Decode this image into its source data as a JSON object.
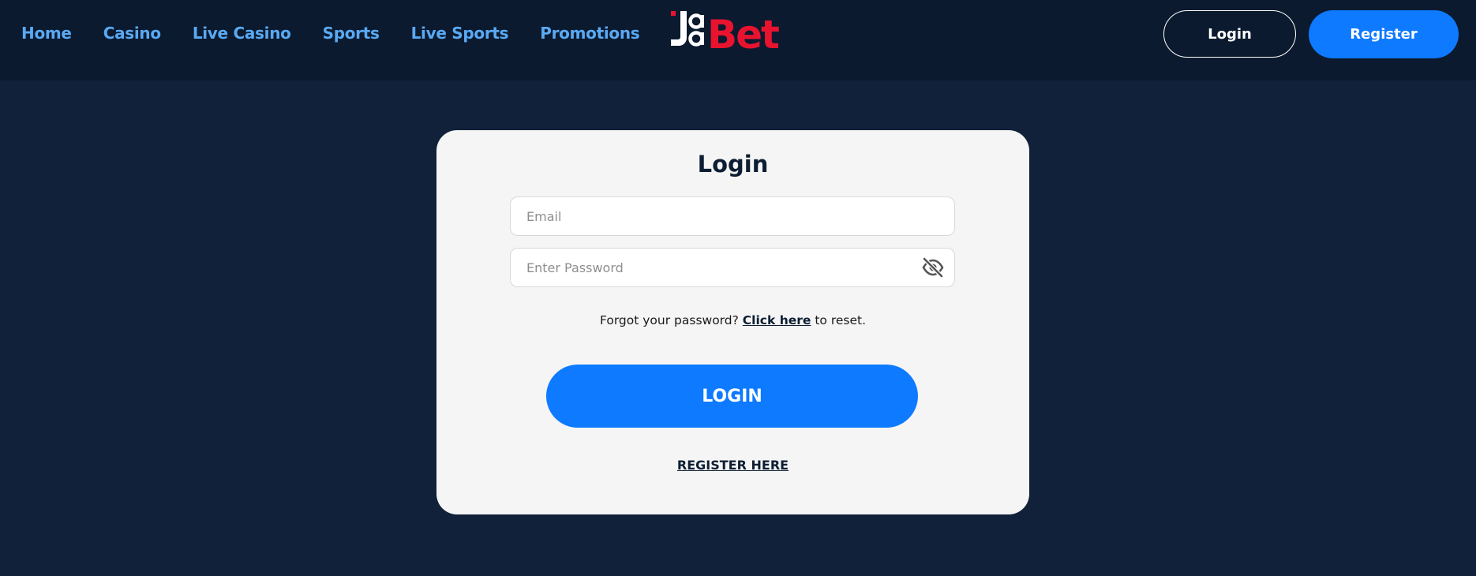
{
  "nav": {
    "items": [
      {
        "label": "Home"
      },
      {
        "label": "Casino"
      },
      {
        "label": "Live Casino"
      },
      {
        "label": "Sports"
      },
      {
        "label": "Live Sports"
      },
      {
        "label": "Promotions"
      }
    ]
  },
  "logo": {
    "text_part1": "Ja",
    "text_part2": "Bet",
    "colors": {
      "white": "#ffffff",
      "red": "#e8132f"
    }
  },
  "header": {
    "login_label": "Login",
    "register_label": "Register"
  },
  "login_form": {
    "title": "Login",
    "email_placeholder": "Email",
    "email_value": "",
    "password_placeholder": "Enter Password",
    "password_value": "",
    "password_toggle_icon": "eye-slash-icon",
    "forgot_prefix": "Forgot your password?",
    "forgot_link": "Click here",
    "forgot_suffix": "to reset.",
    "submit_label": "LOGIN",
    "register_link": "REGISTER HERE"
  },
  "colors": {
    "page_background": "#12213a",
    "header_background": "#0b1a2f",
    "nav_link": "#5aa9f3",
    "primary_button": "#0d7aff",
    "card_background": "#f5f5f5",
    "title_text": "#0d1e33"
  }
}
